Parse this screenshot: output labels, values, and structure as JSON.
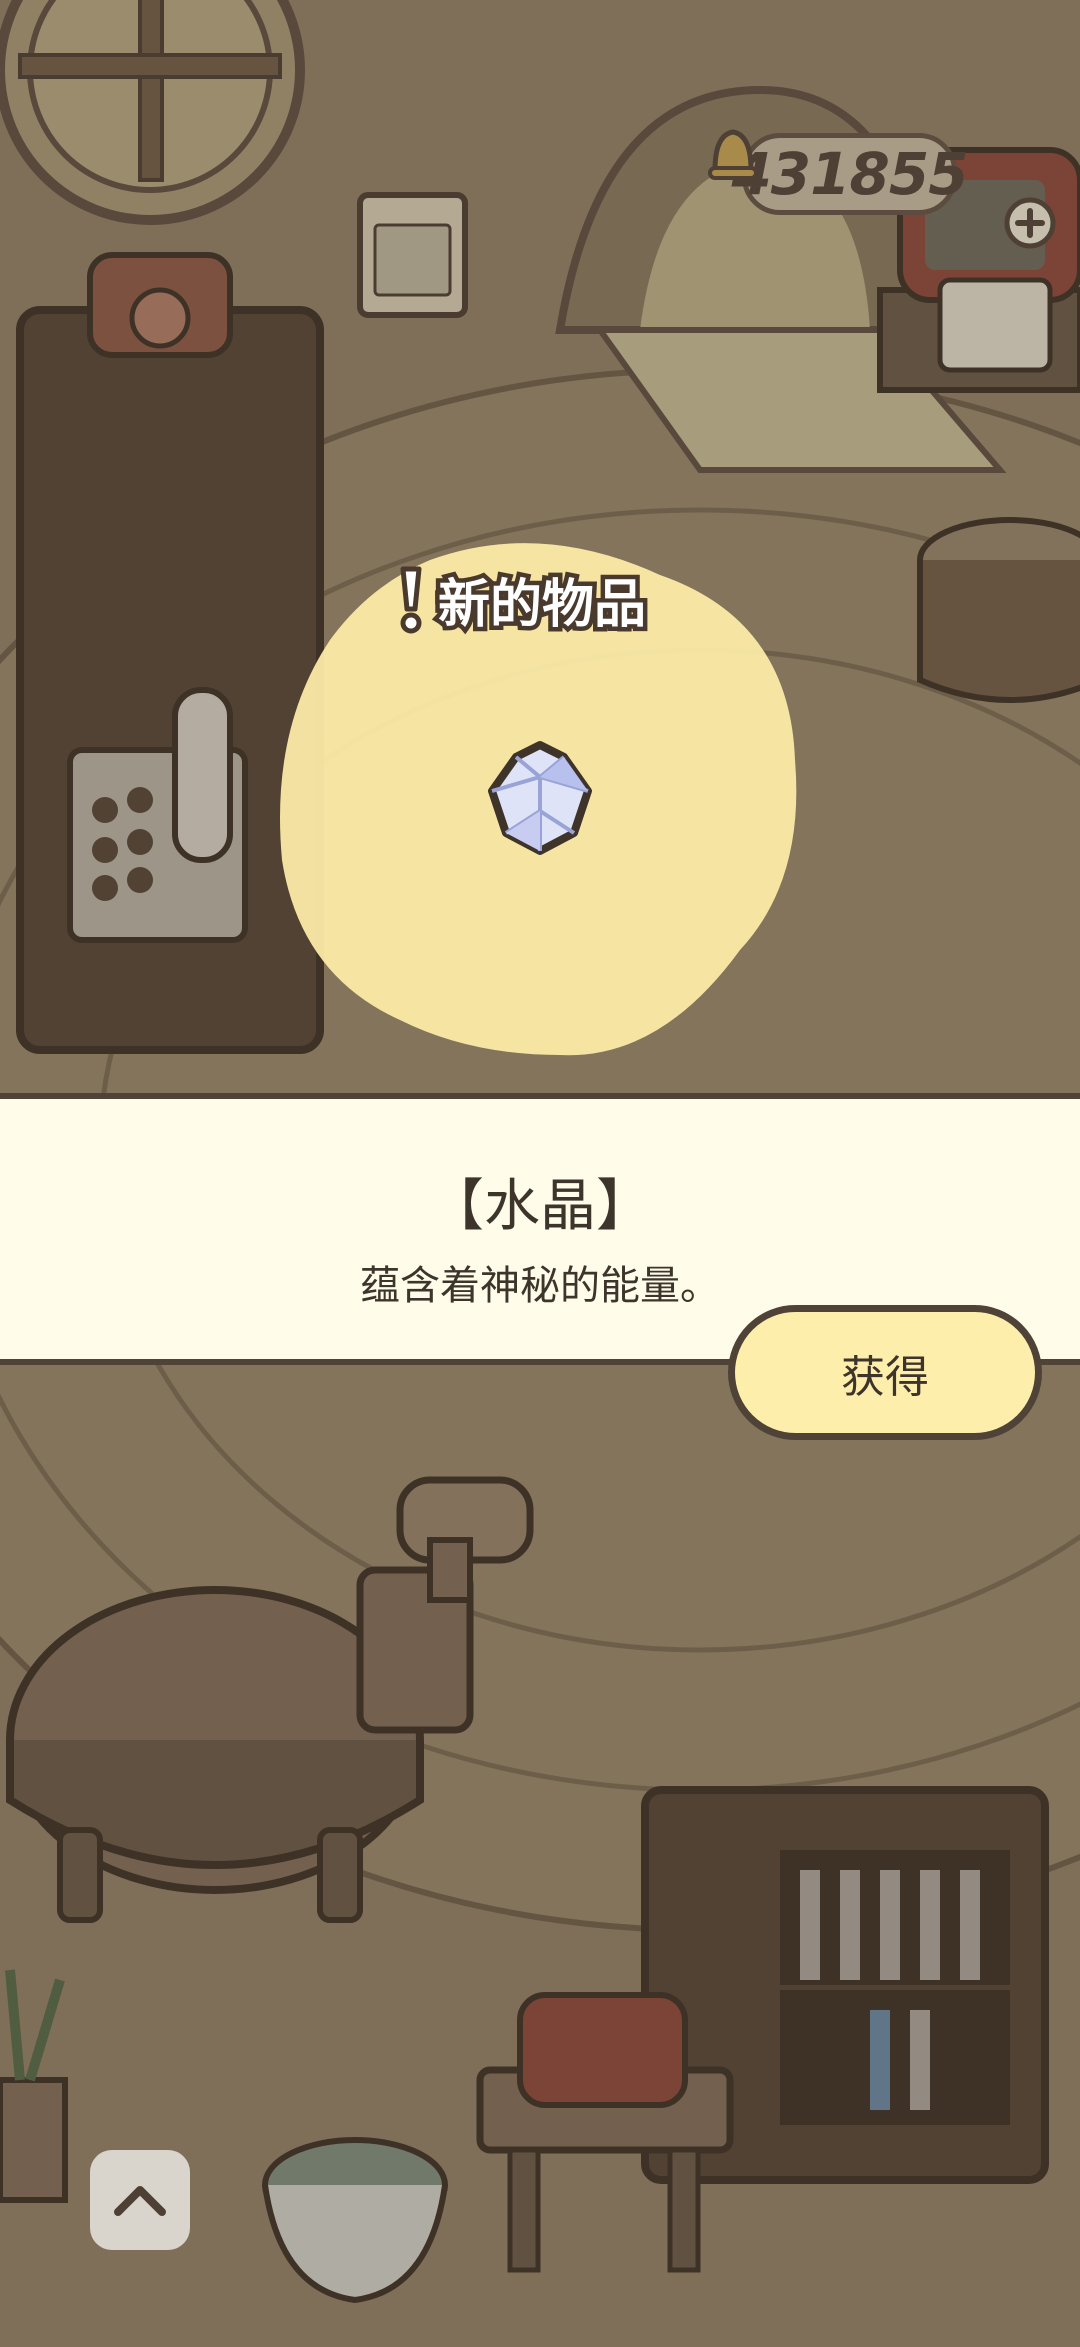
{
  "hud": {
    "coins": "431855",
    "coin_icon": "bell-coin-icon",
    "add_icon": "plus-icon"
  },
  "popup": {
    "header": "新的物品",
    "header_icon": "exclamation-icon",
    "item_icon": "crystal-icon",
    "item_name": "【水晶】",
    "item_description": "蕴含着神秘的能量。",
    "obtain_label": "获得"
  },
  "controls": {
    "expand_icon": "chevron-up-icon"
  },
  "colors": {
    "panel_bg": "#fffcea",
    "button_bg": "#fdeeab",
    "outline": "#4f4237",
    "glow": "#fbeaa6"
  }
}
